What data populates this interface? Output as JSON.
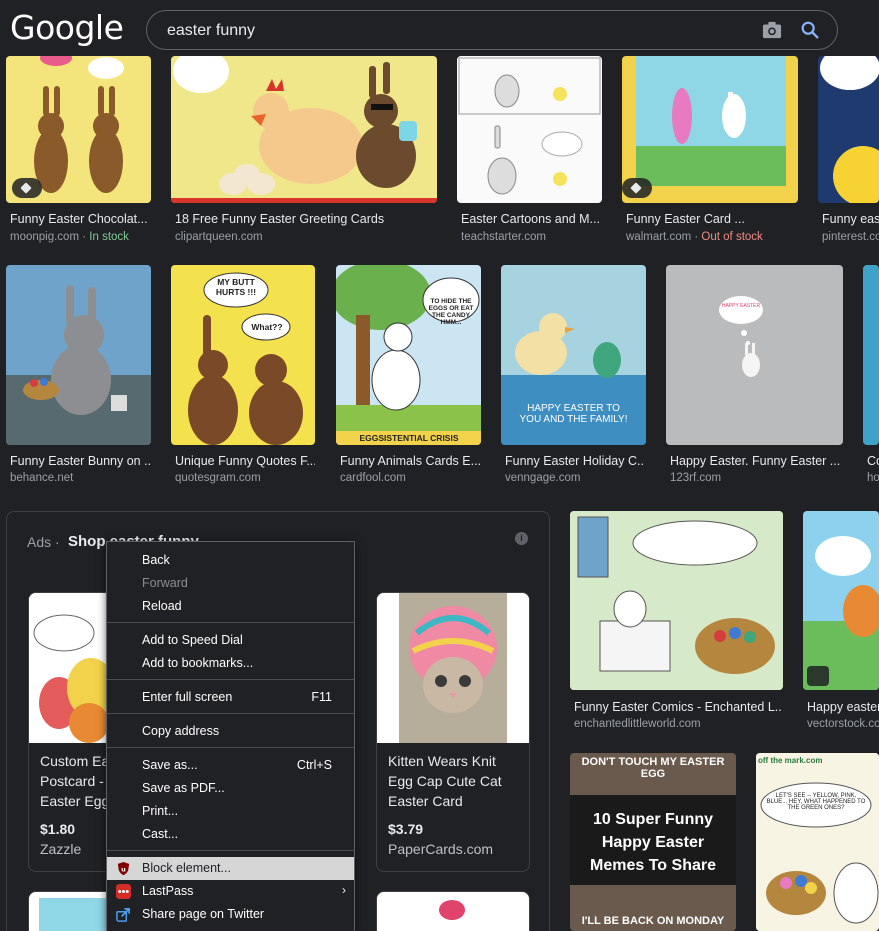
{
  "header": {
    "logo": "Google",
    "query": "easter funny",
    "icons": [
      "camera-icon",
      "search-icon"
    ]
  },
  "row1": [
    {
      "caption": "Funny Easter Chocolat...",
      "source": "moonpig.com",
      "stock": "In stock",
      "stock_status": "in"
    },
    {
      "caption": "18 Free Funny Easter Greeting Cards",
      "source": "clipartqueen.com"
    },
    {
      "caption": "Easter Cartoons and M...",
      "source": "teachstarter.com"
    },
    {
      "caption": "Funny Easter Card ...",
      "source": "walmart.com",
      "stock": "Out of stock",
      "stock_status": "out"
    },
    {
      "caption": "Funny easte",
      "source": "pinterest.co"
    }
  ],
  "row2": [
    {
      "caption": "Funny Easter Bunny on ...",
      "source": "behance.net"
    },
    {
      "caption": "Unique Funny Quotes F...",
      "source": "quotesgram.com",
      "img_text_1": "MY BUTT HURTS !!!",
      "img_text_2": "What??"
    },
    {
      "caption": "Funny Animals Cards E...",
      "source": "cardfool.com",
      "img_text_1": "TO HIDE THE EGGS OR EAT THE CANDY HMM...",
      "img_text_2": "EGGSISTENTIAL CRISIS"
    },
    {
      "caption": "Funny Easter Holiday C...",
      "source": "venngage.com",
      "img_text_1": "HAPPY EASTER TO YOU AND THE FAMILY!"
    },
    {
      "caption": "Happy Easter. Funny Easter ...",
      "source": "123rf.com",
      "img_text_1": "HAPPY EASTER"
    },
    {
      "caption": "Co",
      "source": "ho"
    }
  ],
  "ads": {
    "label": "Ads ·",
    "title": "Shop easter funny",
    "products": [
      {
        "title_lines": [
          "Custom Ea",
          "Postcard -",
          "Easter Egg"
        ],
        "price": "$1.80",
        "seller": "Zazzle"
      },
      {
        "title_lines": [
          "Kitten Wears Knit",
          "Egg Cap Cute Cat",
          "Easter Card"
        ],
        "price": "$3.79",
        "seller": "PaperCards.com"
      }
    ]
  },
  "right_col": [
    {
      "caption": "Funny Easter Comics - Enchanted L...",
      "source": "enchantedlittleworld.com"
    },
    {
      "caption": "Happy easter",
      "source": "vectorstock.co"
    },
    {
      "img_text_1": "DON'T TOUCH MY EASTER EGG",
      "img_text_2": "10 Super Funny Happy Easter Memes To Share",
      "img_text_3": "I'LL BE BACK ON MONDAY"
    },
    {
      "img_text_1": "off the mark.com",
      "img_text_2": "LET'S SEE -- YELLOW, PINK, BLUE... HEY, WHAT HAPPENED TO THE GREEN ONES?"
    }
  ],
  "context_menu": {
    "items": [
      {
        "label": "Back"
      },
      {
        "label": "Forward",
        "disabled": true
      },
      {
        "label": "Reload"
      },
      {
        "label": "Add to Speed Dial"
      },
      {
        "label": "Add to bookmarks..."
      },
      {
        "label": "Enter full screen",
        "shortcut": "F11"
      },
      {
        "label": "Copy address"
      },
      {
        "label": "Save as...",
        "shortcut": "Ctrl+S"
      },
      {
        "label": "Save as PDF..."
      },
      {
        "label": "Print..."
      },
      {
        "label": "Cast..."
      },
      {
        "label": "Block element...",
        "icon": "ublock-shield-icon",
        "highlighted": true
      },
      {
        "label": "LastPass",
        "icon": "lastpass-icon",
        "submenu": true
      },
      {
        "label": "Share page on Twitter",
        "icon": "share-icon"
      }
    ]
  },
  "colors": {
    "background": "#202124",
    "in_stock": "#81c995",
    "out_of_stock": "#f28b82",
    "menu_highlight": "#d6d6d6"
  }
}
